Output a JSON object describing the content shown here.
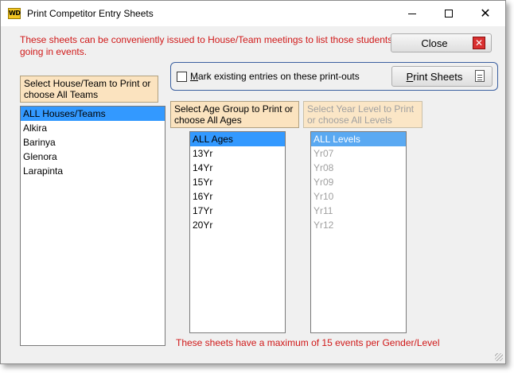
{
  "window": {
    "title": "Print Competitor Entry Sheets",
    "app_icon_text": "WD",
    "controls": {
      "minimize": "—",
      "maximize": "□",
      "close": "✕"
    }
  },
  "info_text": "These sheets can be conveniently issued to House/Team meetings to list those students going in events.",
  "close_button": {
    "label": "Close",
    "icon": "red-x-icon"
  },
  "print_options": {
    "mark_existing_label": "Mark existing entries on these print-outs",
    "mark_existing_checked": false,
    "print_button_label": "Print Sheets",
    "print_icon": "document-icon"
  },
  "house": {
    "caption": "Select House/Team to Print or choose All Teams",
    "items": [
      "ALL Houses/Teams",
      "Alkira",
      "Barinya",
      "Glenora",
      "Larapinta"
    ],
    "selected": 0
  },
  "age": {
    "caption": "Select Age Group to Print or choose All Ages",
    "items": [
      "ALL Ages",
      "13Yr",
      "14Yr",
      "15Yr",
      "16Yr",
      "17Yr",
      "20Yr"
    ],
    "selected": 0
  },
  "year": {
    "caption": "Select Year Level to Print or choose All Levels",
    "items": [
      "ALL Levels",
      "Yr07",
      "Yr08",
      "Yr09",
      "Yr10",
      "Yr11",
      "Yr12"
    ],
    "selected": 0,
    "disabled": true
  },
  "footer_text": "These sheets have a maximum of 15 events per Gender/Level",
  "colors": {
    "info_red": "#d01818",
    "selection_blue": "#3399ff",
    "caption_bg": "#fbe3bf",
    "group_border": "#3a5fa0"
  }
}
